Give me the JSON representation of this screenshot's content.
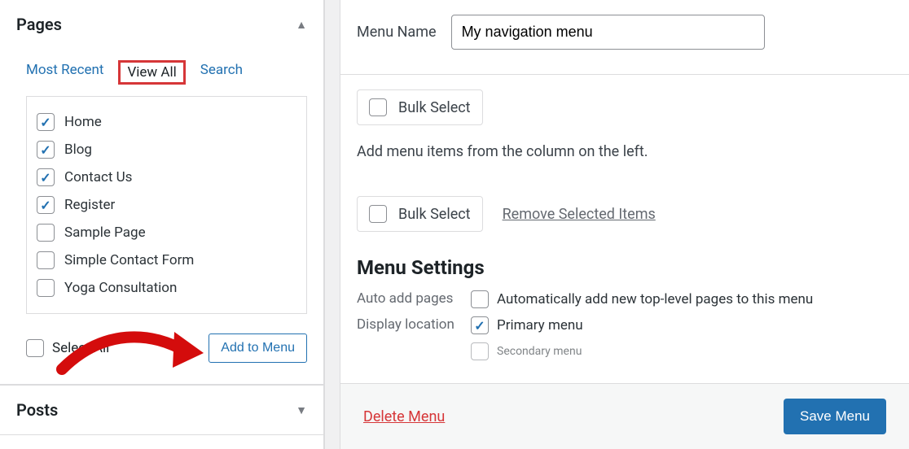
{
  "sidebar": {
    "pages": {
      "title": "Pages",
      "tabs": {
        "recent": "Most Recent",
        "view_all": "View All",
        "search": "Search"
      },
      "items": [
        {
          "label": "Home",
          "checked": true
        },
        {
          "label": "Blog",
          "checked": true
        },
        {
          "label": "Contact Us",
          "checked": true
        },
        {
          "label": "Register",
          "checked": true
        },
        {
          "label": "Sample Page",
          "checked": false
        },
        {
          "label": "Simple Contact Form",
          "checked": false
        },
        {
          "label": "Yoga Consultation",
          "checked": false
        }
      ],
      "select_all": "Select All",
      "add_button": "Add to Menu"
    },
    "posts": {
      "title": "Posts"
    }
  },
  "main": {
    "menu_name_label": "Menu Name",
    "menu_name_value": "My navigation menu",
    "bulk_select": "Bulk Select",
    "hint": "Add menu items from the column on the left.",
    "remove_selected": "Remove Selected Items",
    "settings_title": "Menu Settings",
    "auto_add": {
      "label": "Auto add pages",
      "text": "Automatically add new top-level pages to this menu"
    },
    "display_location": {
      "label": "Display location",
      "primary": "Primary menu",
      "secondary": "Secondary menu",
      "primary_checked": true
    }
  },
  "footer": {
    "delete": "Delete Menu",
    "save": "Save Menu"
  },
  "colors": {
    "link": "#2271b1",
    "danger": "#d63638",
    "annotation": "#d40c0c"
  }
}
